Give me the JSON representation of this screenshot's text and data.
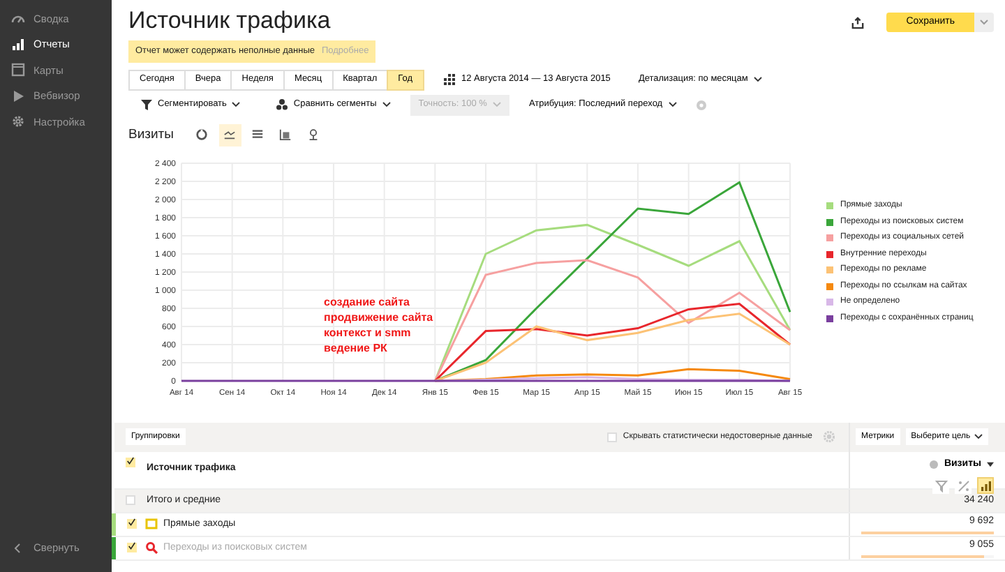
{
  "sidebar": {
    "items": [
      {
        "label": "Сводка",
        "selected": false
      },
      {
        "label": "Отчеты",
        "selected": true
      },
      {
        "label": "Карты",
        "selected": false
      },
      {
        "label": "Вебвизор",
        "selected": false
      },
      {
        "label": "Настройка",
        "selected": false
      }
    ],
    "collapse": "Свернуть"
  },
  "header": {
    "title": "Источник трафика",
    "save": "Сохранить"
  },
  "warning": {
    "text": "Отчет может содержать неполные данные",
    "link": "Подробнее"
  },
  "periods": [
    {
      "label": "Сегодня",
      "selected": false
    },
    {
      "label": "Вчера",
      "selected": false
    },
    {
      "label": "Неделя",
      "selected": false
    },
    {
      "label": "Месяц",
      "selected": false
    },
    {
      "label": "Квартал",
      "selected": false
    },
    {
      "label": "Год",
      "selected": true
    }
  ],
  "date_range": "12 Августа 2014 — 13 Августа 2015",
  "detail": "Детализация: по месяцам",
  "toolbar": [
    {
      "label": "Сегментировать",
      "disabled": false
    },
    {
      "label": "Сравнить сегменты",
      "disabled": false
    },
    {
      "label": "Точность: 100 %",
      "disabled": true
    },
    {
      "label": "Атрибуция: Последний переход",
      "disabled": false
    }
  ],
  "chart_section": {
    "title": "Визиты",
    "views": [
      {
        "selected": false
      },
      {
        "selected": true
      },
      {
        "selected": false
      },
      {
        "selected": false
      },
      {
        "selected": false
      }
    ],
    "chart_data": {
      "type": "line",
      "grid": true,
      "categories": [
        "Авг 14",
        "Сен 14",
        "Окт 14",
        "Ноя 14",
        "Дек 14",
        "Янв 15",
        "Фев 15",
        "Мар 15",
        "Апр 15",
        "Май 15",
        "Июн 15",
        "Июл 15",
        "Авг 15"
      ],
      "ylim": [
        0,
        2400
      ],
      "yticks": [
        {
          "value": 0,
          "label": "0"
        },
        {
          "value": 200,
          "label": "200"
        },
        {
          "value": 400,
          "label": "400"
        },
        {
          "value": 600,
          "label": "600"
        },
        {
          "value": 800,
          "label": "800"
        },
        {
          "value": 1000,
          "label": "1 000"
        },
        {
          "value": 1200,
          "label": "1 200"
        },
        {
          "value": 1400,
          "label": "1 400"
        },
        {
          "value": 1600,
          "label": "1 600"
        },
        {
          "value": 1800,
          "label": "1 800"
        },
        {
          "value": 2000,
          "label": "2 000"
        },
        {
          "value": 2200,
          "label": "2 200"
        },
        {
          "value": 2400,
          "label": "2 400"
        }
      ],
      "series": [
        {
          "name": "Прямые заходы",
          "color": "#a6dc7e",
          "values": [
            null,
            null,
            null,
            null,
            null,
            0,
            1400,
            1660,
            1720,
            1500,
            1270,
            1540,
            560
          ]
        },
        {
          "name": "Переходы из поисковых систем",
          "color": "#3aa63a",
          "values": [
            null,
            null,
            null,
            null,
            null,
            0,
            230,
            800,
            1350,
            1900,
            1840,
            2190,
            760
          ]
        },
        {
          "name": "Переходы из социальных сетей",
          "color": "#f6a0a0",
          "values": [
            null,
            null,
            null,
            null,
            null,
            0,
            1170,
            1300,
            1330,
            1140,
            640,
            970,
            560
          ]
        },
        {
          "name": "Внутренние переходы",
          "color": "#e8262c",
          "values": [
            null,
            null,
            null,
            null,
            null,
            0,
            550,
            570,
            500,
            580,
            790,
            850,
            400
          ]
        },
        {
          "name": "Переходы по рекламе",
          "color": "#fcc275",
          "values": [
            null,
            null,
            null,
            null,
            null,
            0,
            200,
            600,
            450,
            530,
            670,
            740,
            400
          ]
        },
        {
          "name": "Переходы по ссылкам на сайтах",
          "color": "#f5890f",
          "values": [
            null,
            null,
            null,
            null,
            null,
            0,
            20,
            60,
            70,
            60,
            130,
            110,
            20
          ]
        },
        {
          "name": "Не определено",
          "color": "#d8b8e8",
          "values": [
            null,
            null,
            null,
            null,
            null,
            0,
            10,
            30,
            40,
            20,
            10,
            10,
            0
          ]
        },
        {
          "name": "Переходы с сохранённых страниц",
          "color": "#7a3f9e",
          "values": [
            0,
            0,
            0,
            0,
            0,
            0,
            0,
            0,
            0,
            0,
            0,
            0,
            0
          ]
        }
      ],
      "annotations": [
        "создание сайта",
        "продвижение сайта",
        "контекст и smm",
        "ведение РК"
      ]
    }
  },
  "table": {
    "groupings": "Группировки",
    "hide_unreliable": {
      "label": "Скрывать статистически недостоверные данные",
      "checked": false
    },
    "metrics": "Метрики",
    "goal": "Выберите цель",
    "column_1": "Источник трафика",
    "column_1_checked": true,
    "column_2": "Визиты",
    "column_tools": [
      {
        "selected": false
      },
      {
        "selected": false
      },
      {
        "selected": true
      }
    ],
    "total": {
      "label": "Итого и средние",
      "checked": false,
      "value": "34 240"
    },
    "rows": [
      {
        "label": "Прямые заходы",
        "checked": true,
        "dimmed": false,
        "color": "#a6dc7e",
        "value": "9 692",
        "level": 1
      },
      {
        "label": "Переходы из поисковых систем",
        "checked": true,
        "dimmed": true,
        "color": "#3aa63a",
        "value": "9 055",
        "level": 0.93
      }
    ]
  }
}
